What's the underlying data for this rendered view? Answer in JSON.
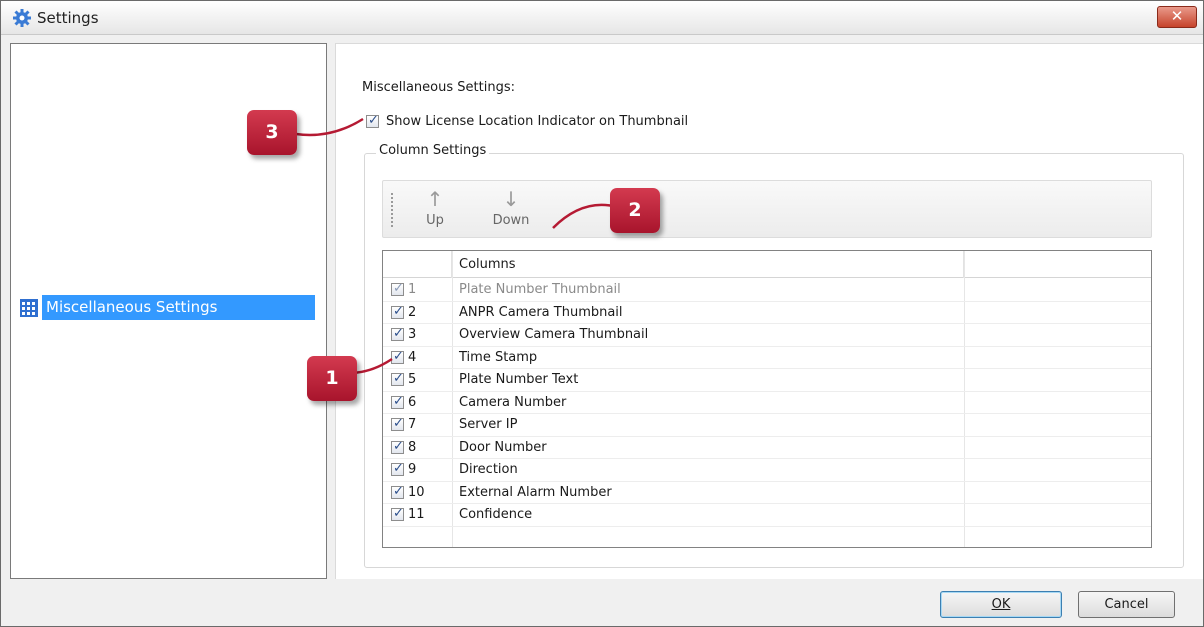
{
  "window": {
    "title": "Settings"
  },
  "left": {
    "items": [
      {
        "label": "Miscellaneous Settings"
      }
    ]
  },
  "misc": {
    "title": "Miscellaneous Settings:",
    "show_license": "Show License Location Indicator on Thumbnail",
    "column_settings": "Column Settings"
  },
  "toolbar": {
    "up": "Up",
    "down": "Down"
  },
  "table": {
    "header": {
      "col1": "",
      "col2": "Columns",
      "col3": ""
    },
    "rows": [
      {
        "num": "1",
        "name": "Plate Number Thumbnail",
        "checked": true,
        "disabled": true
      },
      {
        "num": "2",
        "name": "ANPR Camera Thumbnail",
        "checked": true
      },
      {
        "num": "3",
        "name": "Overview Camera Thumbnail",
        "checked": true
      },
      {
        "num": "4",
        "name": "Time Stamp",
        "checked": true
      },
      {
        "num": "5",
        "name": "Plate Number Text",
        "checked": true
      },
      {
        "num": "6",
        "name": "Camera Number",
        "checked": true
      },
      {
        "num": "7",
        "name": "Server IP",
        "checked": true
      },
      {
        "num": "8",
        "name": "Door Number",
        "checked": true
      },
      {
        "num": "9",
        "name": "Direction",
        "checked": true
      },
      {
        "num": "10",
        "name": "External Alarm Number",
        "checked": true
      },
      {
        "num": "11",
        "name": "Confidence",
        "checked": true
      }
    ]
  },
  "buttons": {
    "ok": "OK",
    "cancel": "Cancel"
  },
  "callouts": {
    "c1": "1",
    "c2": "2",
    "c3": "3"
  },
  "colors": {
    "selection": "#3399ff",
    "callout": "#b51a33"
  }
}
